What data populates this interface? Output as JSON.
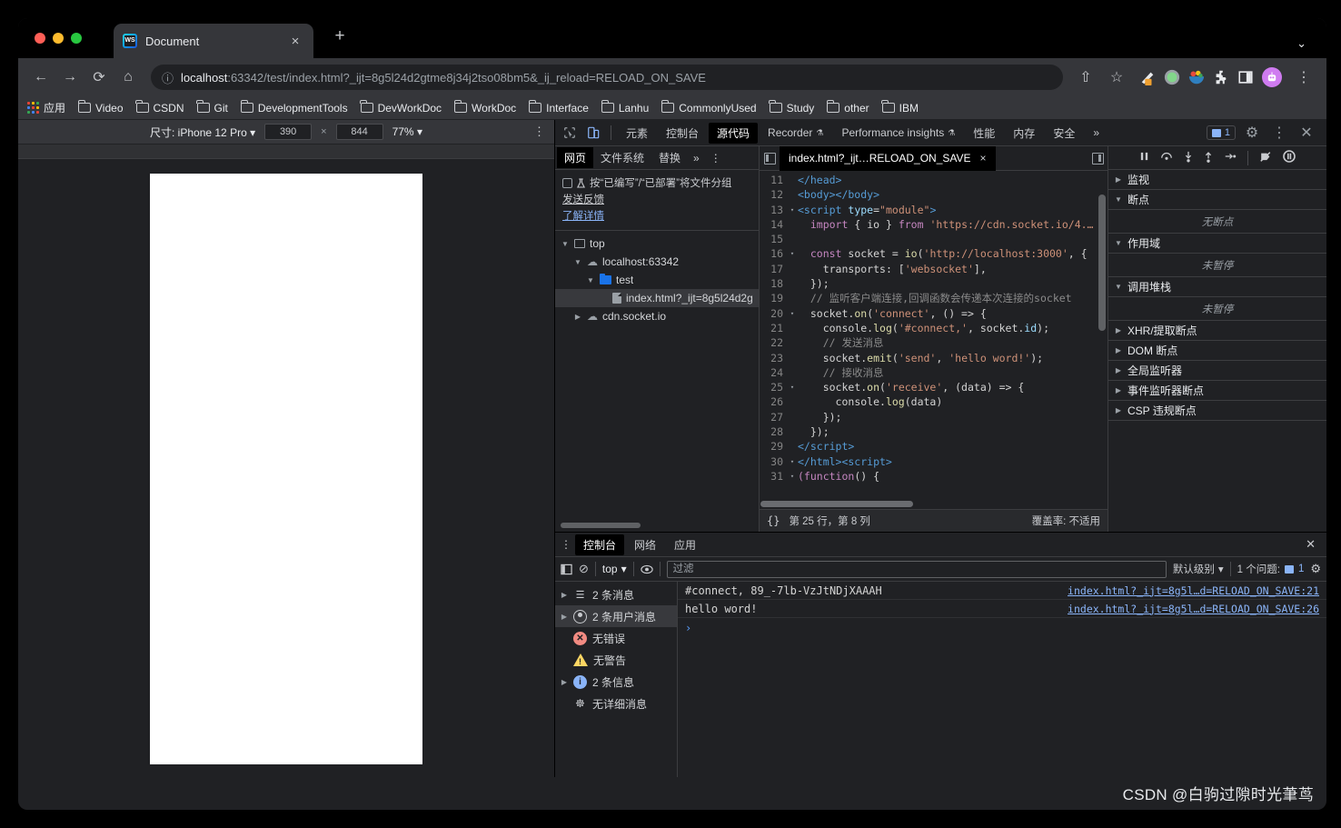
{
  "browser": {
    "tab": {
      "title": "Document",
      "favicon": "webstorm-icon",
      "close": "×"
    },
    "new_tab": "+",
    "window_chevron": "⌄",
    "nav": {
      "back": "←",
      "forward": "→",
      "reload": "⟳",
      "home": "⌂",
      "info_icon": "ⓘ",
      "url_host": "localhost",
      "url_rest": ":63342/test/index.html?_ijt=8g5l24d2gtme8j34j2tso08bm5&_ij_reload=RELOAD_ON_SAVE",
      "share": "⇧",
      "star": "☆",
      "menu": "⋮"
    },
    "bookmarks": [
      {
        "label": "应用",
        "icon": "apps-grid-icon"
      },
      {
        "label": "Video",
        "icon": "folder-icon"
      },
      {
        "label": "CSDN",
        "icon": "folder-icon"
      },
      {
        "label": "Git",
        "icon": "folder-icon"
      },
      {
        "label": "DevelopmentTools",
        "icon": "folder-icon"
      },
      {
        "label": "DevWorkDoc",
        "icon": "folder-icon"
      },
      {
        "label": "WorkDoc",
        "icon": "folder-icon"
      },
      {
        "label": "Interface",
        "icon": "folder-icon"
      },
      {
        "label": "Lanhu",
        "icon": "folder-icon"
      },
      {
        "label": "CommonlyUsed",
        "icon": "folder-icon"
      },
      {
        "label": "Study",
        "icon": "folder-icon"
      },
      {
        "label": "other",
        "icon": "folder-icon"
      },
      {
        "label": "IBM",
        "icon": "folder-icon"
      }
    ]
  },
  "device_toolbar": {
    "size_label": "尺寸: iPhone 12 Pro",
    "caret": "▾",
    "width": "390",
    "x": "×",
    "height": "844",
    "zoom": "77%",
    "kebab": "⋮"
  },
  "devtools": {
    "inspect_icon": "cursor-inspect-icon",
    "device_icon": "device-toggle-icon",
    "tabs": [
      {
        "label": "元素",
        "active": false,
        "warn": false
      },
      {
        "label": "控制台",
        "active": false,
        "warn": false
      },
      {
        "label": "源代码",
        "active": true,
        "warn": false
      },
      {
        "label": "Recorder",
        "active": false,
        "warn": true
      },
      {
        "label": "Performance insights",
        "active": false,
        "warn": true
      },
      {
        "label": "性能",
        "active": false,
        "warn": false
      },
      {
        "label": "内存",
        "active": false,
        "warn": false
      },
      {
        "label": "安全",
        "active": false,
        "warn": false
      }
    ],
    "overflow": "»",
    "issue_count": "1",
    "settings": "⚙",
    "kebab": "⋮",
    "close": "✕"
  },
  "navigator": {
    "tabs": [
      {
        "label": "网页",
        "active": true
      },
      {
        "label": "文件系统",
        "active": false
      },
      {
        "label": "替换",
        "active": false
      }
    ],
    "overflow": "»",
    "kebab": "⋮",
    "group_checkbox_label": "按“已编写”/“已部署”将文件分组",
    "feedback_link": "发送反馈",
    "learn_more_link": "了解详情",
    "tree": [
      {
        "label": "top",
        "icon": "frame-icon",
        "indent": 0,
        "expanded": true,
        "selected": false
      },
      {
        "label": "localhost:63342",
        "icon": "cloud-icon",
        "indent": 1,
        "expanded": true,
        "selected": false
      },
      {
        "label": "test",
        "icon": "folder-icon",
        "indent": 2,
        "expanded": true,
        "selected": false
      },
      {
        "label": "index.html?_ijt=8g5l24d2g",
        "icon": "file-icon",
        "indent": 3,
        "expanded": null,
        "selected": true
      },
      {
        "label": "cdn.socket.io",
        "icon": "cloud-icon",
        "indent": 1,
        "expanded": false,
        "selected": false
      }
    ]
  },
  "editor": {
    "tab_label": "index.html?_ijt…RELOAD_ON_SAVE",
    "tab_close": "×",
    "prev_icon": "scroll-tabs-left-icon",
    "next_icon": "scroll-tabs-right-icon",
    "lines": [
      {
        "n": "11",
        "fold": "",
        "html": "<span class=\"tag\">&lt;/head&gt;</span>"
      },
      {
        "n": "12",
        "fold": "",
        "html": "<span class=\"tag\">&lt;body&gt;&lt;/body&gt;</span>"
      },
      {
        "n": "13",
        "fold": "▾",
        "html": "<span class=\"tag\">&lt;script</span> <span class=\"attr\">type</span><span class=\"pun\">=</span><span class=\"str\">\"module\"</span><span class=\"tag\">&gt;</span>"
      },
      {
        "n": "14",
        "fold": "",
        "html": "  <span class=\"kw\">import</span> <span class=\"ct\">{ io } </span><span class=\"kw\">from</span> <span class=\"str\">'https://cdn.socket.io/4.…</span>"
      },
      {
        "n": "15",
        "fold": "",
        "html": ""
      },
      {
        "n": "16",
        "fold": "▾",
        "html": "  <span class=\"kw\">const</span> <span class=\"ct\">socket = </span><span class=\"fn\">io</span><span class=\"ct\">(</span><span class=\"str\">'http://localhost:3000'</span><span class=\"ct\">, {</span>"
      },
      {
        "n": "17",
        "fold": "",
        "html": "    <span class=\"ct\">transports: [</span><span class=\"str\">'websocket'</span><span class=\"ct\">],</span>"
      },
      {
        "n": "18",
        "fold": "",
        "html": "  <span class=\"ct\">});</span>"
      },
      {
        "n": "19",
        "fold": "",
        "html": "  <span class=\"cmt\">// 监听客户端连接,回调函数会传递本次连接的socket</span>"
      },
      {
        "n": "20",
        "fold": "▾",
        "html": "  <span class=\"ct\">socket.</span><span class=\"fn\">on</span><span class=\"ct\">(</span><span class=\"str\">'connect'</span><span class=\"ct\">, () =&gt; {</span>"
      },
      {
        "n": "21",
        "fold": "",
        "html": "    <span class=\"ct\">console.</span><span class=\"fn\">log</span><span class=\"ct\">(</span><span class=\"str\">'#connect,'</span><span class=\"ct\">, socket.</span><span class=\"obj\">id</span><span class=\"ct\">);</span>"
      },
      {
        "n": "22",
        "fold": "",
        "html": "    <span class=\"cmt\">// 发送消息</span>"
      },
      {
        "n": "23",
        "fold": "",
        "html": "    <span class=\"ct\">socket.</span><span class=\"fn\">emit</span><span class=\"ct\">(</span><span class=\"str\">'send'</span><span class=\"ct\">, </span><span class=\"str\">'hello word!'</span><span class=\"ct\">);</span>"
      },
      {
        "n": "24",
        "fold": "",
        "html": "    <span class=\"cmt\">// 接收消息</span>"
      },
      {
        "n": "25",
        "fold": "▾",
        "html": "    <span class=\"ct\">socket.</span><span class=\"fn\">on</span><span class=\"ct\">(</span><span class=\"str\">'receive'</span><span class=\"ct\">, (data) =&gt; {</span>"
      },
      {
        "n": "26",
        "fold": "",
        "html": "      <span class=\"ct\">console.</span><span class=\"fn\">log</span><span class=\"ct\">(data)</span>"
      },
      {
        "n": "27",
        "fold": "",
        "html": "    <span class=\"ct\">});</span>"
      },
      {
        "n": "28",
        "fold": "",
        "html": "  <span class=\"ct\">});</span>"
      },
      {
        "n": "29",
        "fold": "",
        "html": "<span class=\"tag\">&lt;/script&gt;</span>"
      },
      {
        "n": "30",
        "fold": "▾",
        "html": "<span class=\"tag\">&lt;/html&gt;&lt;script&gt;</span>"
      },
      {
        "n": "31",
        "fold": "▾",
        "html": "<span class=\"kw\">(function</span><span class=\"ct\">() {</span>"
      }
    ],
    "status": {
      "pretty_print": "{}",
      "cursor": "第 25 行，第 8 列",
      "coverage": "覆盖率: 不适用"
    }
  },
  "debugger": {
    "toolbar": [
      "pause-icon",
      "step-over-icon",
      "step-into-icon",
      "step-out-icon",
      "step-icon",
      "deactivate-breakpoints-icon",
      "pause-on-exceptions-icon"
    ],
    "sections": [
      {
        "label": "监视",
        "expanded": false,
        "empty": null
      },
      {
        "label": "断点",
        "expanded": true,
        "empty": "无断点"
      },
      {
        "label": "作用域",
        "expanded": true,
        "empty": "未暂停"
      },
      {
        "label": "调用堆栈",
        "expanded": true,
        "empty": "未暂停"
      },
      {
        "label": "XHR/提取断点",
        "expanded": false,
        "empty": null
      },
      {
        "label": "DOM 断点",
        "expanded": false,
        "empty": null
      },
      {
        "label": "全局监听器",
        "expanded": false,
        "empty": null
      },
      {
        "label": "事件监听器断点",
        "expanded": false,
        "empty": null
      },
      {
        "label": "CSP 违规断点",
        "expanded": false,
        "empty": null
      }
    ]
  },
  "drawer": {
    "kebab": "⋮",
    "tabs": [
      {
        "label": "控制台",
        "active": true
      },
      {
        "label": "网络",
        "active": false
      },
      {
        "label": "应用",
        "active": false
      }
    ],
    "close": "✕",
    "toolbar": {
      "sidebar_toggle": "console-sidebar-toggle-icon",
      "clear": "⊘",
      "context": "top",
      "caret": "▾",
      "eye": "◉",
      "filter_placeholder": "过滤",
      "level": "默认级别",
      "issues_label": "1 个问题:",
      "issues_count": "1",
      "settings": "⚙"
    },
    "sidebar": [
      {
        "label": "2 条消息",
        "icon": "list-icon",
        "expandable": true,
        "selected": false
      },
      {
        "label": "2 条用户消息",
        "icon": "user-icon",
        "expandable": true,
        "selected": true
      },
      {
        "label": "无错误",
        "icon": "error-icon",
        "expandable": false,
        "selected": false
      },
      {
        "label": "无警告",
        "icon": "warning-icon",
        "expandable": false,
        "selected": false
      },
      {
        "label": "2 条信息",
        "icon": "info-icon",
        "expandable": true,
        "selected": false
      },
      {
        "label": "无详细消息",
        "icon": "verbose-icon",
        "expandable": false,
        "selected": false
      }
    ],
    "logs": [
      {
        "message": "#connect, 89_-7lb-VzJtNDjXAAAH",
        "source": "index.html?_ijt=8g5l…d=RELOAD_ON_SAVE:21"
      },
      {
        "message": "hello word!",
        "source": "index.html?_ijt=8g5l…d=RELOAD_ON_SAVE:26"
      }
    ],
    "prompt": "›"
  },
  "watermark": "CSDN @白驹过隙时光茟茑",
  "colors": {
    "accent_blue": "#8ab4f8",
    "folder_blue": "#1a73e8",
    "error_red": "#f28b82",
    "warn_yellow": "#fdd663",
    "devtools_bg": "#202124",
    "chrome_bg": "#35363a"
  }
}
